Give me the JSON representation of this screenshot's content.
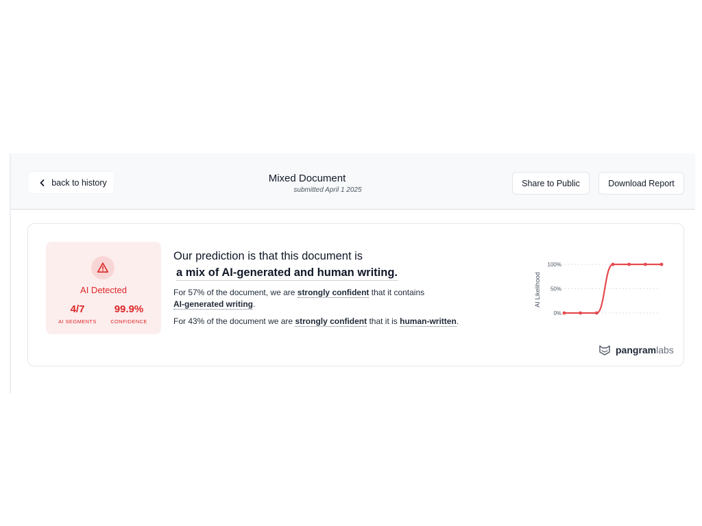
{
  "header": {
    "back_label": "back to history",
    "title": "Mixed Document",
    "subtitle": "submitted April 1 2025",
    "share_label": "Share to Public",
    "download_label": "Download Report"
  },
  "verdict": {
    "icon": "warning-triangle-icon",
    "label": "AI Detected",
    "segments_value": "4/7",
    "segments_label": "AI SEGMENTS",
    "confidence_value": "99.9%",
    "confidence_label": "CONFIDENCE"
  },
  "prediction": {
    "line1": "Our prediction is that this document is",
    "line2": "a mix of AI-generated and human writing.",
    "p1_pre": "For 57% of the document, we are ",
    "p1_bold": "strongly confident",
    "p1_post": " that it contains",
    "p1_bold2": "AI-generated writing",
    "p1_end": ".",
    "p2_pre": "For 43% of the document we are ",
    "p2_bold": "strongly confident",
    "p2_mid": " that it is ",
    "p2_bold2": "human-written",
    "p2_end": "."
  },
  "chart_data": {
    "type": "line",
    "ylabel": "AI Likelihood",
    "y_ticks": [
      "100%",
      "50%",
      "0%"
    ],
    "ylim": [
      0,
      100
    ],
    "x": [
      1,
      2,
      3,
      4,
      5,
      6,
      7
    ],
    "series": [
      {
        "values": [
          0,
          0,
          0,
          100,
          100,
          100,
          100
        ]
      }
    ],
    "grid": true,
    "color": "#e5484d"
  },
  "brand": {
    "name_bold": "pangram",
    "name_light": "labs"
  }
}
